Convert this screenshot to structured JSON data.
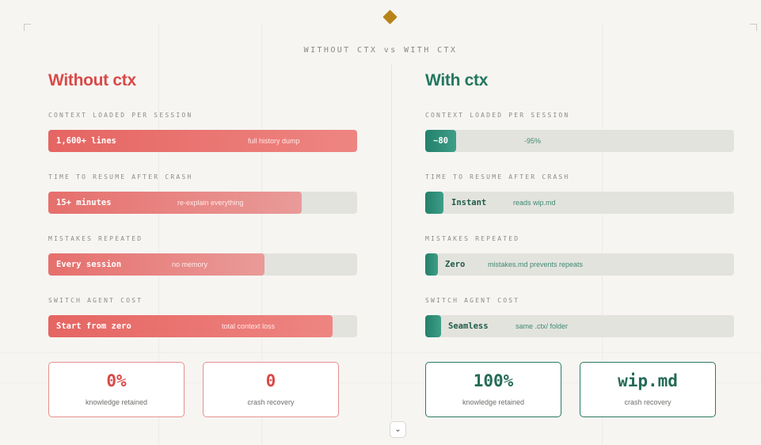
{
  "heading": "WITHOUT CTX vs WITH CTX",
  "icons": {
    "top": "diamond-icon",
    "scroll": "chevron-down-icon"
  },
  "colors": {
    "accent_gold": "#b88419",
    "without": "#d94a47",
    "with": "#23775f"
  },
  "left": {
    "title": "Without ctx",
    "metrics": [
      {
        "label": "CONTEXT LOADED PER SESSION",
        "value": "1,600+ lines",
        "note": "full history dump",
        "fill": 1.0
      },
      {
        "label": "TIME TO RESUME AFTER CRASH",
        "value": "15+ minutes",
        "note": "re-explain everything",
        "fill": 0.82
      },
      {
        "label": "MISTAKES REPEATED",
        "value": "Every session",
        "note": "no memory",
        "fill": 0.7
      },
      {
        "label": "SWITCH AGENT COST",
        "value": "Start from zero",
        "note": "total context loss",
        "fill": 0.92
      }
    ],
    "cards": [
      {
        "value": "0%",
        "label": "knowledge retained"
      },
      {
        "value": "0",
        "label": "crash recovery"
      }
    ]
  },
  "right": {
    "title": "With ctx",
    "metrics": [
      {
        "label": "CONTEXT LOADED PER SESSION",
        "value": "~80",
        "note": "-95%",
        "fill": 0.1
      },
      {
        "label": "TIME TO RESUME AFTER CRASH",
        "value": "Instant",
        "note": "reads wip.md",
        "fill": 0.06
      },
      {
        "label": "MISTAKES REPEATED",
        "value": "Zero",
        "note": "mistakes.md prevents repeats",
        "fill": 0.04
      },
      {
        "label": "SWITCH AGENT COST",
        "value": "Seamless",
        "note": "same .ctx/ folder",
        "fill": 0.05
      }
    ],
    "cards": [
      {
        "value": "100%",
        "label": "knowledge retained"
      },
      {
        "value": "wip.md",
        "label": "crash recovery"
      }
    ]
  },
  "scroll_glyph": "⌄"
}
